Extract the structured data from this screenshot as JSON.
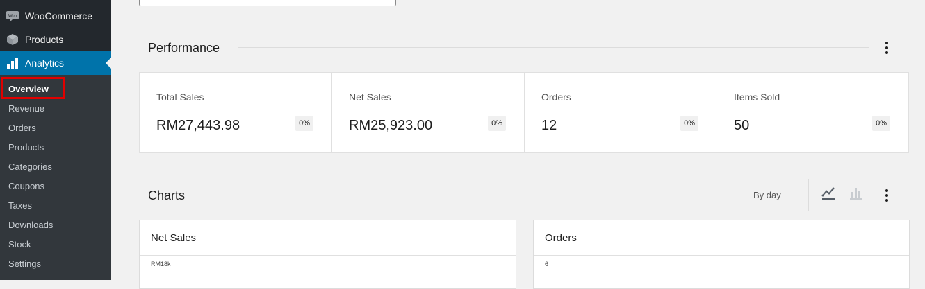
{
  "sidebar": {
    "top_items": [
      {
        "label": "WooCommerce",
        "icon": "woocommerce-icon",
        "active": false
      },
      {
        "label": "Products",
        "icon": "products-box-icon",
        "active": false
      },
      {
        "label": "Analytics",
        "icon": "analytics-bar-icon",
        "active": true
      }
    ],
    "woo_icon_text": "Woo",
    "submenu": [
      {
        "label": "Overview",
        "current": true
      },
      {
        "label": "Revenue",
        "current": false
      },
      {
        "label": "Orders",
        "current": false
      },
      {
        "label": "Products",
        "current": false
      },
      {
        "label": "Categories",
        "current": false
      },
      {
        "label": "Coupons",
        "current": false
      },
      {
        "label": "Taxes",
        "current": false
      },
      {
        "label": "Downloads",
        "current": false
      },
      {
        "label": "Stock",
        "current": false
      },
      {
        "label": "Settings",
        "current": false
      }
    ]
  },
  "performance": {
    "title": "Performance",
    "cards": [
      {
        "label": "Total Sales",
        "value": "RM27,443.98",
        "delta": "0%"
      },
      {
        "label": "Net Sales",
        "value": "RM25,923.00",
        "delta": "0%"
      },
      {
        "label": "Orders",
        "value": "12",
        "delta": "0%"
      },
      {
        "label": "Items Sold",
        "value": "50",
        "delta": "0%"
      }
    ]
  },
  "charts": {
    "title": "Charts",
    "interval": "By day",
    "panels": [
      {
        "title": "Net Sales",
        "y_tick": "RM18k"
      },
      {
        "title": "Orders",
        "y_tick": "6"
      }
    ]
  },
  "colors": {
    "sidebar_bg": "#23282d",
    "submenu_bg": "#32373c",
    "active_blue": "#0073aa",
    "highlight_red": "#e10000",
    "page_bg": "#f1f1f1"
  }
}
